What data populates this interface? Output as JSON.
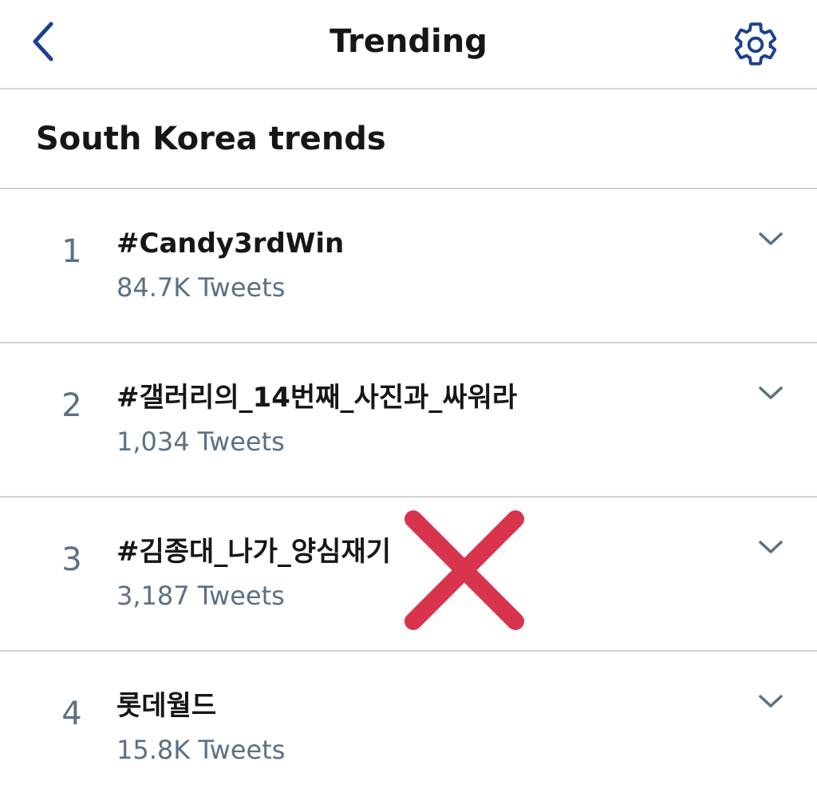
{
  "header": {
    "title": "Trending",
    "back_icon": "chevron-left-icon",
    "settings_icon": "gear-icon"
  },
  "section": {
    "title": "South Korea trends"
  },
  "trends": [
    {
      "rank": "1",
      "name": "#Candy3rdWin",
      "tweets": "84.7K Tweets"
    },
    {
      "rank": "2",
      "name": "#갤러리의_14번째_사진과_싸워라",
      "tweets": "1,034 Tweets"
    },
    {
      "rank": "3",
      "name": "#김종대_나가_양심재기",
      "tweets": "3,187 Tweets"
    },
    {
      "rank": "4",
      "name": "롯데월드",
      "tweets": "15.8K Tweets"
    }
  ],
  "overlay": {
    "icon": "red-x-mark-icon",
    "color": "#d8344e"
  },
  "colors": {
    "accent": "#1d3f8f",
    "text_primary": "#14171a",
    "text_secondary": "#5b7083",
    "divider": "#cdd3d8"
  }
}
